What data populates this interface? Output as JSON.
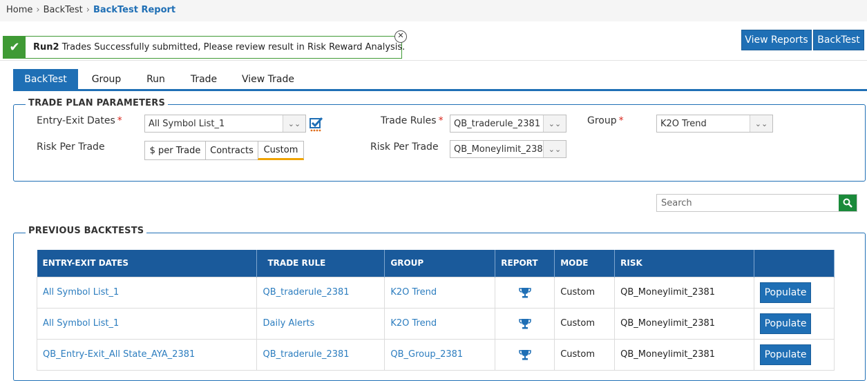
{
  "breadcrumb": {
    "home": "Home",
    "backtest": "BackTest",
    "current": "BackTest Report",
    "separator": "›"
  },
  "alert": {
    "bold": "Run2",
    "message": " Trades Successfully submitted, Please review result in Risk Reward Analysis.",
    "close_glyph": "✕",
    "ok_glyph": "✔"
  },
  "top_buttons": {
    "view_reports": "View Reports",
    "backtest": "BackTest"
  },
  "tabs": [
    "BackTest",
    "Group",
    "Run",
    "Trade",
    "View Trade"
  ],
  "trade_plan": {
    "title": "TRADE PLAN PARAMETERS",
    "entry_exit_label": "Entry-Exit Dates",
    "entry_exit_value": "All Symbol List_1",
    "risk_per_trade_label": "Risk Per Trade",
    "risk_options": [
      "$ per Trade",
      "Contracts",
      "Custom"
    ],
    "trade_rules_label": "Trade Rules",
    "trade_rules_value": "QB_traderule_2381",
    "risk_per_trade_label2": "Risk Per Trade",
    "risk_value": "QB_Moneylimit_2381",
    "group_label": "Group",
    "group_value": "K2O Trend",
    "required_mark": "*",
    "dropdown_glyph": "⌄⌄"
  },
  "search": {
    "placeholder": "Search"
  },
  "previous": {
    "title": "PREVIOUS BACKTESTS",
    "columns": [
      "ENTRY-EXIT DATES",
      "TRADE RULE",
      "GROUP",
      "REPORT",
      "MODE",
      "RISK",
      ""
    ],
    "rows": [
      {
        "dates": "All Symbol List_1",
        "rule": "QB_traderule_2381",
        "group": "K2O Trend",
        "mode": "Custom",
        "risk": "QB_Moneylimit_2381",
        "action": "Populate"
      },
      {
        "dates": "All Symbol List_1",
        "rule": "Daily Alerts",
        "group": "K2O Trend",
        "mode": "Custom",
        "risk": "QB_Moneylimit_2381",
        "action": "Populate"
      },
      {
        "dates": "QB_Entry-Exit_All State_AYA_2381",
        "rule": "QB_traderule_2381",
        "group": "QB_Group_2381",
        "mode": "Custom",
        "risk": "QB_Moneylimit_2381",
        "action": "Populate"
      }
    ]
  },
  "colors": {
    "primary": "#1f6fb5",
    "header": "#1a5a9b",
    "success": "#3f9a35",
    "link": "#2c7dbf",
    "accent": "#f0a400",
    "search_btn": "#1a8a3a"
  }
}
